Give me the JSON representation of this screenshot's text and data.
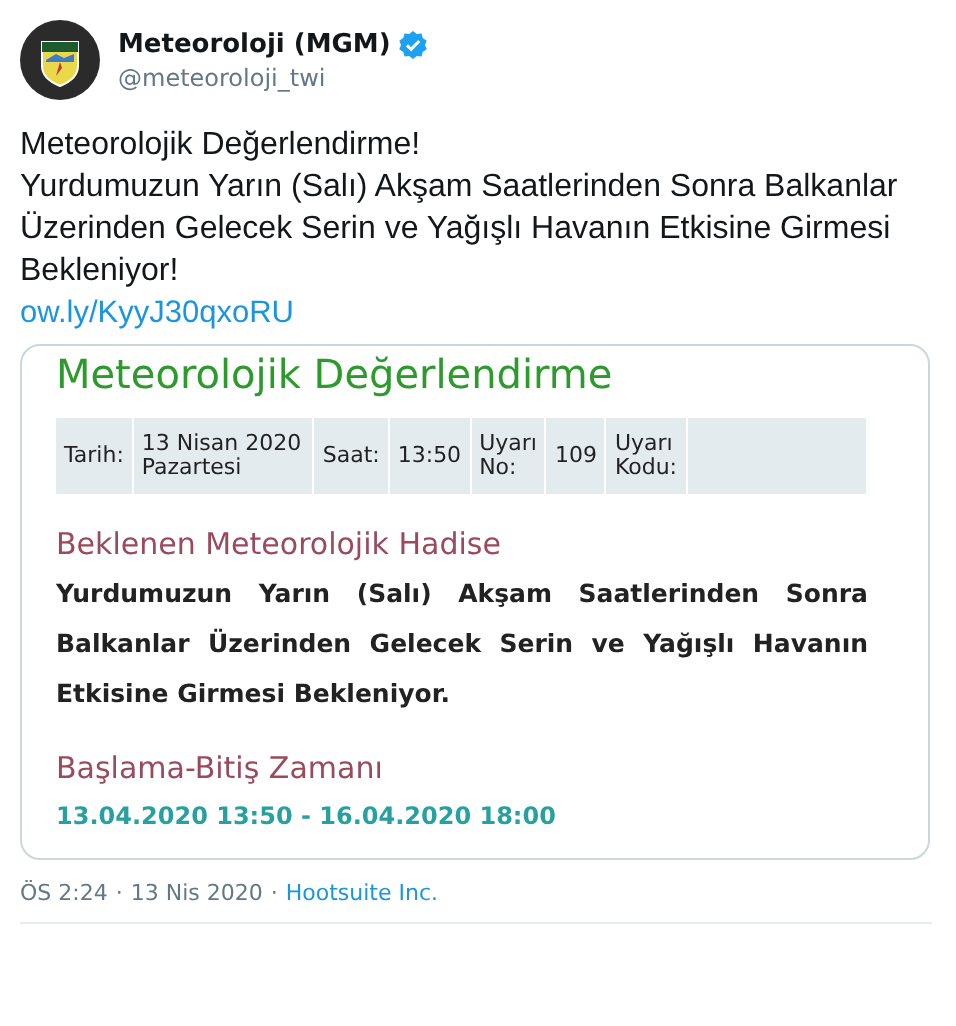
{
  "author": {
    "name": "Meteoroloji (MGM)",
    "verified": true,
    "handle": "@meteoroloji_twi"
  },
  "tweet_text": "Meteorolojik Değerlendirme!\nYurdumuzun Yarın (Salı) Akşam Saatlerinden Sonra Balkanlar Üzerinden Gelecek Serin ve Yağışlı Havanın Etkisine Girmesi Bekleniyor!",
  "link": "ow.ly/KyyJ30qxoRU",
  "card": {
    "title": "Meteorolojik Değerlendirme",
    "info_table": [
      {
        "label": "Tarih:",
        "value": "13 Nisan 2020\nPazartesi"
      },
      {
        "label": "Saat:",
        "value": "13:50"
      },
      {
        "label": "Uyarı\nNo:",
        "value": "109"
      },
      {
        "label": "Uyarı\nKodu:"
      }
    ],
    "sections": [
      {
        "heading": "Beklenen Meteorolojik Hadise",
        "kind": "text",
        "body": "Yurdumuzun Yarın (Salı) Akşam Saatlerinden Sonra Balkanlar Üzerinden Gelecek Serin ve Yağışlı Havanın Etkisine Girmesi Bekleniyor."
      },
      {
        "heading": "Başlama-Bitiş Zamanı",
        "kind": "time",
        "body": "13.04.2020 13:50 - 16.04.2020 18:00"
      }
    ]
  },
  "footer": {
    "time": "ÖS 2:24",
    "separator_1": "·",
    "date": "13 Nis 2020",
    "separator_2": "·",
    "source": "Hootsuite Inc."
  }
}
